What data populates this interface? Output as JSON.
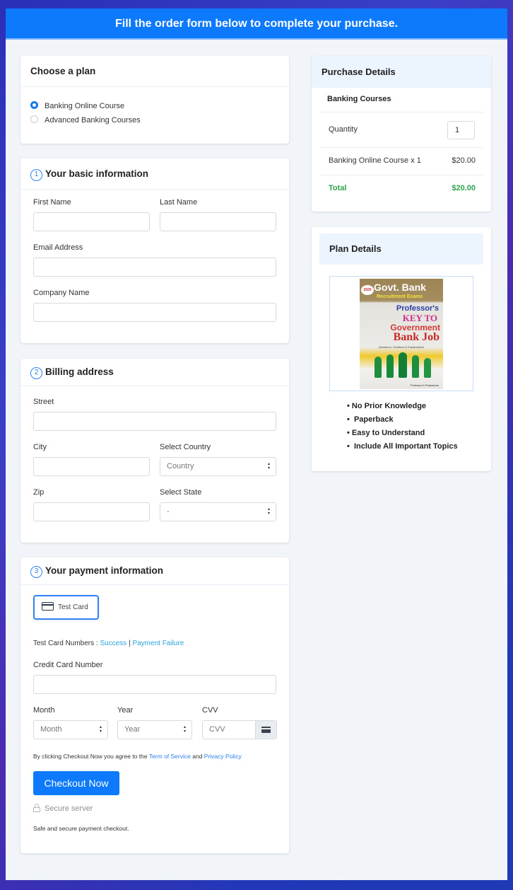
{
  "banner": {
    "text": "Fill the order form below to complete your purchase."
  },
  "choose_plan": {
    "title": "Choose a plan",
    "options": [
      {
        "label": "Banking Online Course",
        "selected": true
      },
      {
        "label": "Advanced Banking Courses",
        "selected": false
      }
    ]
  },
  "basic_info": {
    "step": "1",
    "title": "Your basic information",
    "first_name_label": "First Name",
    "last_name_label": "Last Name",
    "email_label": "Email Address",
    "company_label": "Company Name"
  },
  "billing": {
    "step": "2",
    "title": "Billing address",
    "street_label": "Street",
    "city_label": "City",
    "country_label": "Select Country",
    "country_value": "Country",
    "zip_label": "Zip",
    "state_label": "Select State",
    "state_value": "-"
  },
  "payment": {
    "step": "3",
    "title": "Your payment information",
    "method_label": "Test Card",
    "test_numbers_prefix": "Test Card Numbers :",
    "success_link": "Success",
    "separator": "|",
    "failure_link": "Payment Failure",
    "card_number_label": "Credit Card Number",
    "month_label": "Month",
    "month_value": "Month",
    "year_label": "Year",
    "year_value": "Year",
    "cvv_label": "CVV",
    "cvv_placeholder": "CVV",
    "agree_prefix": "By clicking Checkout Now you agree to the",
    "terms_link": "Term of Service",
    "agree_and": "and",
    "privacy_link": "Privacy Policy",
    "checkout_button": "Checkout Now",
    "secure_label": "Secure server",
    "safe_text": "Safe and secure payment checkout."
  },
  "purchase_details": {
    "title": "Purchase Details",
    "product_group": "Banking Courses",
    "quantity_label": "Quantity",
    "quantity_value": "1",
    "line_item_label": "Banking Online Course x 1",
    "line_item_price": "$20.00",
    "total_label": "Total",
    "total_value": "$20.00"
  },
  "plan_details": {
    "title": "Plan Details",
    "book": {
      "edition": "2020",
      "line1": "Govt. Bank",
      "line2": "Recruitment Exams",
      "line3": "Professor's",
      "line4": "KEY TO",
      "line5": "Government",
      "line6": "Bank Job",
      "line7": "Questions, Solutions & Explanations",
      "publisher": "Professor's Prakashan"
    },
    "features": [
      "No Prior Knowledge",
      "Paperback",
      "Easy to Understand",
      "Include All Important Topics"
    ]
  },
  "colors": {
    "accent": "#0d79fb",
    "total_green": "#2ea44f",
    "link_teal": "#2aa4dc"
  }
}
